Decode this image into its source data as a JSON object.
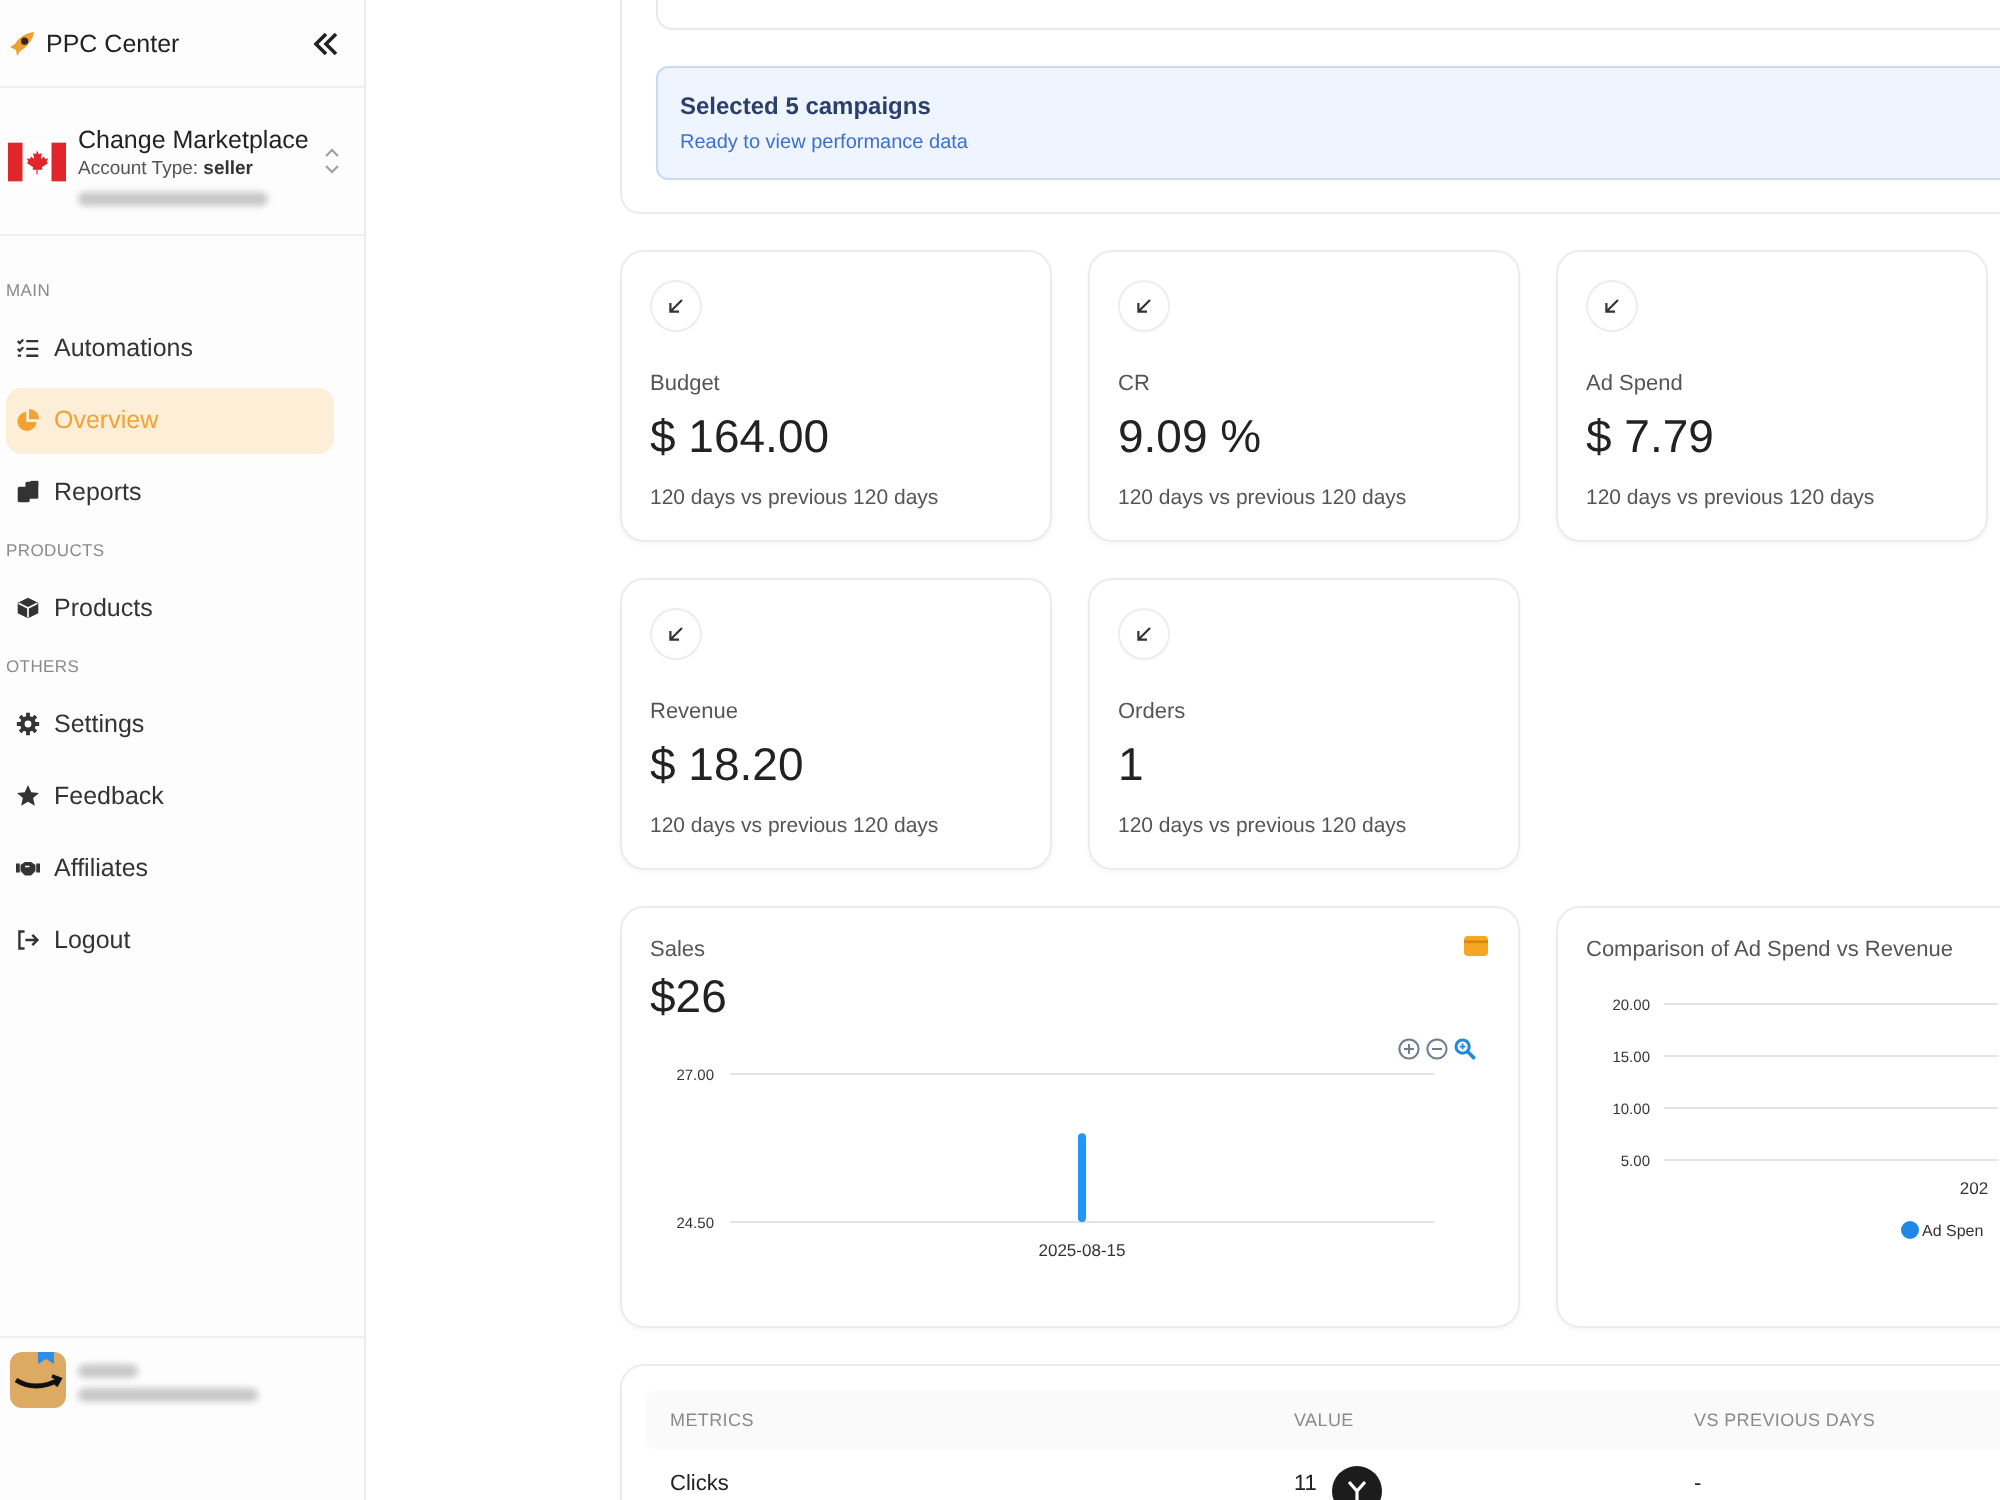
{
  "sidebar": {
    "brand": "PPC Center",
    "marketplace": {
      "title": "Change Marketplace",
      "account_type": "Account Type: **seller**"
    },
    "items": [
      {
        "kind": "section",
        "label": "MAIN"
      },
      {
        "kind": "link",
        "label": "Automations",
        "selected": false
      },
      {
        "kind": "link",
        "label": "Overview",
        "selected": true
      },
      {
        "kind": "link",
        "label": "Reports",
        "selected": false
      },
      {
        "kind": "section",
        "label": "PRODUCTS"
      },
      {
        "kind": "link",
        "label": "Products",
        "selected": false
      },
      {
        "kind": "section",
        "label": "OTHERS"
      },
      {
        "kind": "link",
        "label": "Settings",
        "selected": false
      },
      {
        "kind": "link",
        "label": "Feedback",
        "selected": false
      },
      {
        "kind": "link",
        "label": "Affiliates",
        "selected": false
      },
      {
        "kind": "link",
        "label": "Logout",
        "selected": false
      }
    ]
  },
  "campaign_notice": {
    "title": "Selected 5 campaigns",
    "subtitle": "Ready to view performance data"
  },
  "stats": [
    {
      "label": "Budget",
      "value": "$ 164.00",
      "period": "120 days vs previous 120 days"
    },
    {
      "label": "CR",
      "value": "9.09 %",
      "period": "120 days vs previous 120 days"
    },
    {
      "label": "Ad Spend",
      "value": "$ 7.79",
      "period": "120 days vs previous 120 days"
    },
    {
      "label": "Revenue",
      "value": "$ 18.20",
      "period": "120 days vs previous 120 days"
    },
    {
      "label": "Orders",
      "value": "1",
      "period": "120 days vs previous 120 days"
    }
  ],
  "sales": {
    "title": "Sales",
    "total": "$26",
    "chart_data": {
      "type": "bar",
      "categories": [
        "2025-08-15"
      ],
      "values": [
        26
      ],
      "ylim": [
        24.5,
        27
      ],
      "yticks": [
        {
          "value": 24.5,
          "label": "24.50"
        },
        {
          "value": 27,
          "label": "27.00"
        }
      ]
    }
  },
  "comparison": {
    "title": "Comparison of Ad Spend vs Revenue",
    "y_axis_labels": [
      "20.00",
      "15.00",
      "10.00",
      "5.00"
    ],
    "x_axis_label": "202",
    "legend": [
      {
        "name": "Ad Spen",
        "color": "#1e88e5"
      }
    ]
  },
  "metrics_table": {
    "columns": [
      "METRICS",
      "VALUE",
      "VS PREVIOUS DAYS"
    ],
    "rows": [
      [
        "Clicks",
        "11",
        "-"
      ]
    ]
  }
}
